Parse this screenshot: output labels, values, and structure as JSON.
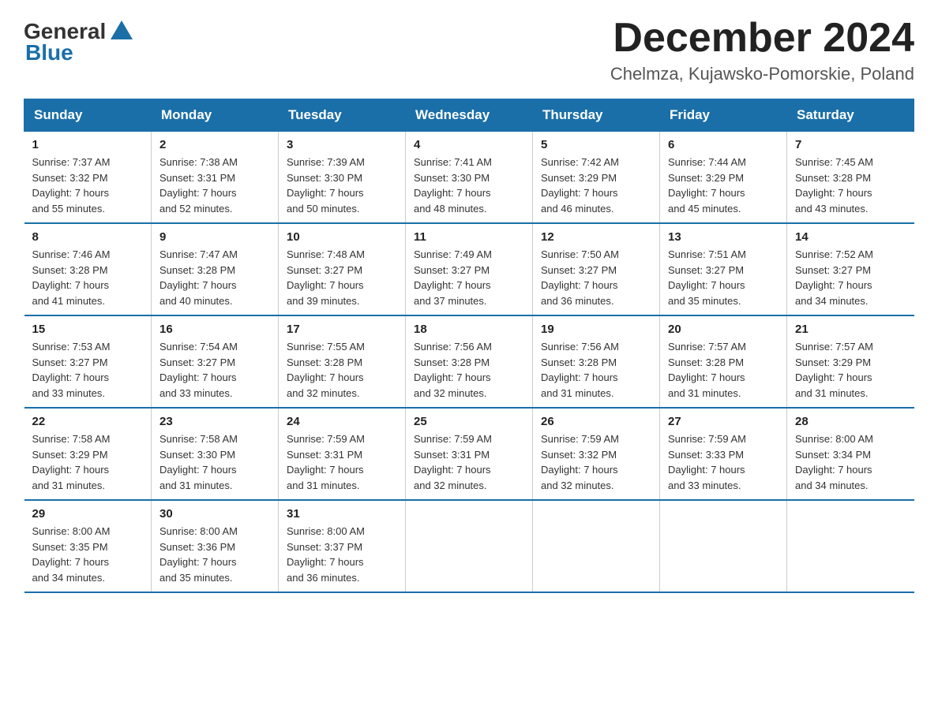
{
  "logo": {
    "text1": "General",
    "text2": "Blue"
  },
  "title": "December 2024",
  "location": "Chelmza, Kujawsko-Pomorskie, Poland",
  "headers": [
    "Sunday",
    "Monday",
    "Tuesday",
    "Wednesday",
    "Thursday",
    "Friday",
    "Saturday"
  ],
  "weeks": [
    [
      {
        "day": "1",
        "info": "Sunrise: 7:37 AM\nSunset: 3:32 PM\nDaylight: 7 hours\nand 55 minutes."
      },
      {
        "day": "2",
        "info": "Sunrise: 7:38 AM\nSunset: 3:31 PM\nDaylight: 7 hours\nand 52 minutes."
      },
      {
        "day": "3",
        "info": "Sunrise: 7:39 AM\nSunset: 3:30 PM\nDaylight: 7 hours\nand 50 minutes."
      },
      {
        "day": "4",
        "info": "Sunrise: 7:41 AM\nSunset: 3:30 PM\nDaylight: 7 hours\nand 48 minutes."
      },
      {
        "day": "5",
        "info": "Sunrise: 7:42 AM\nSunset: 3:29 PM\nDaylight: 7 hours\nand 46 minutes."
      },
      {
        "day": "6",
        "info": "Sunrise: 7:44 AM\nSunset: 3:29 PM\nDaylight: 7 hours\nand 45 minutes."
      },
      {
        "day": "7",
        "info": "Sunrise: 7:45 AM\nSunset: 3:28 PM\nDaylight: 7 hours\nand 43 minutes."
      }
    ],
    [
      {
        "day": "8",
        "info": "Sunrise: 7:46 AM\nSunset: 3:28 PM\nDaylight: 7 hours\nand 41 minutes."
      },
      {
        "day": "9",
        "info": "Sunrise: 7:47 AM\nSunset: 3:28 PM\nDaylight: 7 hours\nand 40 minutes."
      },
      {
        "day": "10",
        "info": "Sunrise: 7:48 AM\nSunset: 3:27 PM\nDaylight: 7 hours\nand 39 minutes."
      },
      {
        "day": "11",
        "info": "Sunrise: 7:49 AM\nSunset: 3:27 PM\nDaylight: 7 hours\nand 37 minutes."
      },
      {
        "day": "12",
        "info": "Sunrise: 7:50 AM\nSunset: 3:27 PM\nDaylight: 7 hours\nand 36 minutes."
      },
      {
        "day": "13",
        "info": "Sunrise: 7:51 AM\nSunset: 3:27 PM\nDaylight: 7 hours\nand 35 minutes."
      },
      {
        "day": "14",
        "info": "Sunrise: 7:52 AM\nSunset: 3:27 PM\nDaylight: 7 hours\nand 34 minutes."
      }
    ],
    [
      {
        "day": "15",
        "info": "Sunrise: 7:53 AM\nSunset: 3:27 PM\nDaylight: 7 hours\nand 33 minutes."
      },
      {
        "day": "16",
        "info": "Sunrise: 7:54 AM\nSunset: 3:27 PM\nDaylight: 7 hours\nand 33 minutes."
      },
      {
        "day": "17",
        "info": "Sunrise: 7:55 AM\nSunset: 3:28 PM\nDaylight: 7 hours\nand 32 minutes."
      },
      {
        "day": "18",
        "info": "Sunrise: 7:56 AM\nSunset: 3:28 PM\nDaylight: 7 hours\nand 32 minutes."
      },
      {
        "day": "19",
        "info": "Sunrise: 7:56 AM\nSunset: 3:28 PM\nDaylight: 7 hours\nand 31 minutes."
      },
      {
        "day": "20",
        "info": "Sunrise: 7:57 AM\nSunset: 3:28 PM\nDaylight: 7 hours\nand 31 minutes."
      },
      {
        "day": "21",
        "info": "Sunrise: 7:57 AM\nSunset: 3:29 PM\nDaylight: 7 hours\nand 31 minutes."
      }
    ],
    [
      {
        "day": "22",
        "info": "Sunrise: 7:58 AM\nSunset: 3:29 PM\nDaylight: 7 hours\nand 31 minutes."
      },
      {
        "day": "23",
        "info": "Sunrise: 7:58 AM\nSunset: 3:30 PM\nDaylight: 7 hours\nand 31 minutes."
      },
      {
        "day": "24",
        "info": "Sunrise: 7:59 AM\nSunset: 3:31 PM\nDaylight: 7 hours\nand 31 minutes."
      },
      {
        "day": "25",
        "info": "Sunrise: 7:59 AM\nSunset: 3:31 PM\nDaylight: 7 hours\nand 32 minutes."
      },
      {
        "day": "26",
        "info": "Sunrise: 7:59 AM\nSunset: 3:32 PM\nDaylight: 7 hours\nand 32 minutes."
      },
      {
        "day": "27",
        "info": "Sunrise: 7:59 AM\nSunset: 3:33 PM\nDaylight: 7 hours\nand 33 minutes."
      },
      {
        "day": "28",
        "info": "Sunrise: 8:00 AM\nSunset: 3:34 PM\nDaylight: 7 hours\nand 34 minutes."
      }
    ],
    [
      {
        "day": "29",
        "info": "Sunrise: 8:00 AM\nSunset: 3:35 PM\nDaylight: 7 hours\nand 34 minutes."
      },
      {
        "day": "30",
        "info": "Sunrise: 8:00 AM\nSunset: 3:36 PM\nDaylight: 7 hours\nand 35 minutes."
      },
      {
        "day": "31",
        "info": "Sunrise: 8:00 AM\nSunset: 3:37 PM\nDaylight: 7 hours\nand 36 minutes."
      },
      {
        "day": "",
        "info": ""
      },
      {
        "day": "",
        "info": ""
      },
      {
        "day": "",
        "info": ""
      },
      {
        "day": "",
        "info": ""
      }
    ]
  ]
}
